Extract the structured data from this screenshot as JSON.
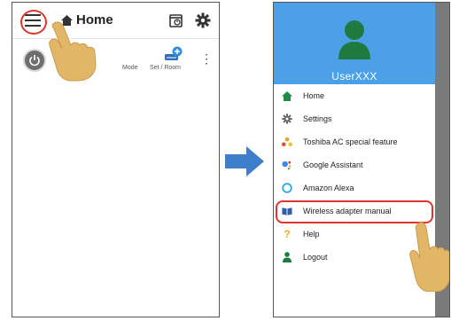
{
  "left_screen": {
    "title": "Home",
    "mode_label": "Mode",
    "set_room_label": "Set / Room"
  },
  "right_screen": {
    "username": "UserXXX",
    "menu": [
      {
        "label": "Home",
        "icon": "home-icon"
      },
      {
        "label": "Settings",
        "icon": "gear-icon"
      },
      {
        "label": "Toshiba AC special feature",
        "icon": "special-feature-icon"
      },
      {
        "label": "Google Assistant",
        "icon": "google-assistant-icon"
      },
      {
        "label": "Amazon Alexa",
        "icon": "alexa-icon"
      },
      {
        "label": "Wireless adapter manual",
        "icon": "book-icon"
      },
      {
        "label": "Help",
        "icon": "question-icon"
      },
      {
        "label": "Logout",
        "icon": "person-icon"
      }
    ]
  },
  "colors": {
    "header_blue": "#4ba0e8",
    "highlight_red": "#e0332e",
    "arrow_blue": "#3d7ecb",
    "hand_skin": "#e2b667"
  }
}
